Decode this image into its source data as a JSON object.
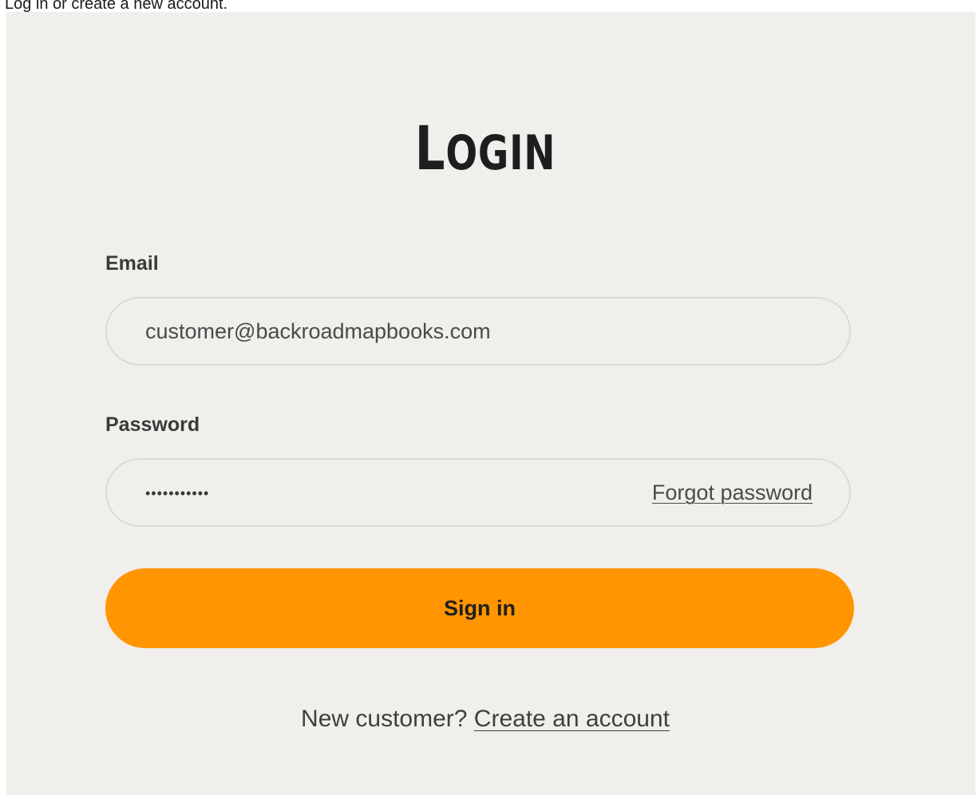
{
  "page": {
    "caption": "Log in or create a new account."
  },
  "login": {
    "title_first": "L",
    "title_rest": "OGIN",
    "email_label": "Email",
    "email_value": "customer@backroadmapbooks.com",
    "password_label": "Password",
    "password_value": "•••••••••••",
    "forgot_label": "Forgot password",
    "signin_label": "Sign in",
    "new_customer_text": "New customer?",
    "create_account_label": "Create an account"
  },
  "colors": {
    "panel_bg": "#f1efeb",
    "accent": "#ff9500",
    "field_border": "#dcdad5"
  }
}
